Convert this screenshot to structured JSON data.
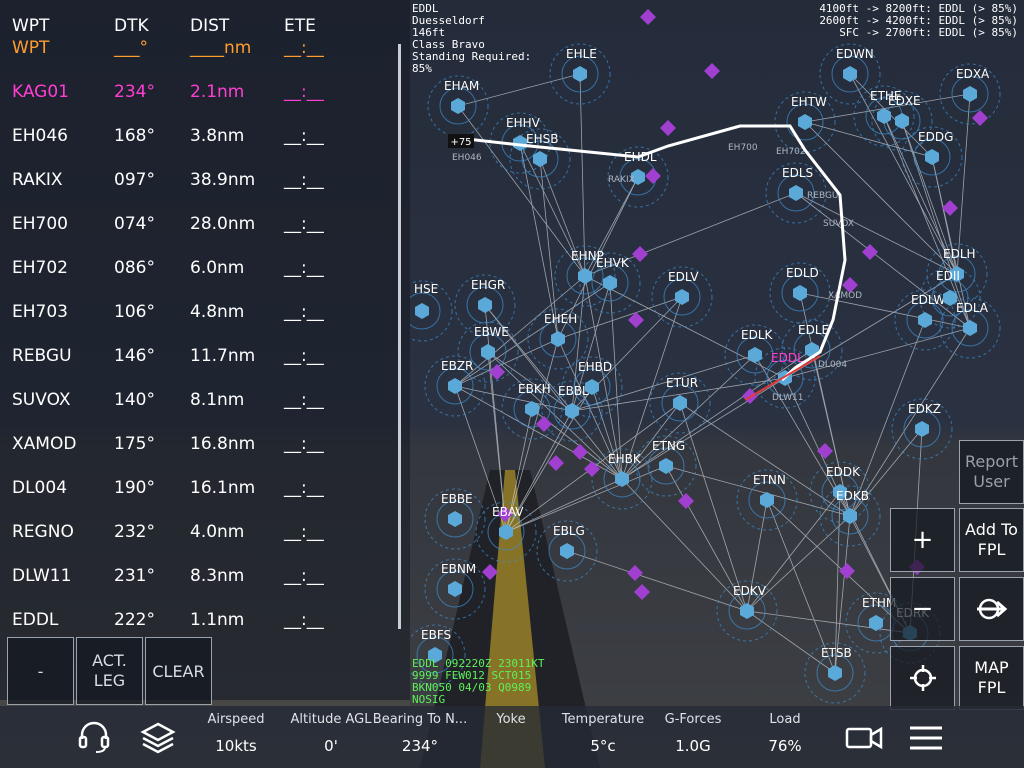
{
  "fpl": {
    "headers": {
      "wpt": "WPT",
      "dtk": "DTK",
      "dist": "DIST",
      "ete": "ETE"
    },
    "partial_row": {
      "wpt": "WPT",
      "dtk": "___°",
      "dist": "____nm",
      "ete": "__:__"
    },
    "rows": [
      {
        "wpt": "KAG01",
        "dtk": "234°",
        "dist": "2.1nm",
        "ete": "__:__",
        "active": true
      },
      {
        "wpt": "EH046",
        "dtk": "168°",
        "dist": "3.8nm",
        "ete": "__:__"
      },
      {
        "wpt": "RAKIX",
        "dtk": "097°",
        "dist": "38.9nm",
        "ete": "__:__"
      },
      {
        "wpt": "EH700",
        "dtk": "074°",
        "dist": "28.0nm",
        "ete": "__:__"
      },
      {
        "wpt": "EH702",
        "dtk": "086°",
        "dist": "6.0nm",
        "ete": "__:__"
      },
      {
        "wpt": "EH703",
        "dtk": "106°",
        "dist": "4.8nm",
        "ete": "__:__"
      },
      {
        "wpt": "REBGU",
        "dtk": "146°",
        "dist": "11.7nm",
        "ete": "__:__"
      },
      {
        "wpt": "SUVOX",
        "dtk": "140°",
        "dist": "8.1nm",
        "ete": "__:__"
      },
      {
        "wpt": "XAMOD",
        "dtk": "175°",
        "dist": "16.8nm",
        "ete": "__:__"
      },
      {
        "wpt": "DL004",
        "dtk": "190°",
        "dist": "16.1nm",
        "ete": "__:__"
      },
      {
        "wpt": "REGNO",
        "dtk": "232°",
        "dist": "4.0nm",
        "ete": "__:__"
      },
      {
        "wpt": "DLW11",
        "dtk": "231°",
        "dist": "8.3nm",
        "ete": "__:__"
      },
      {
        "wpt": "EDDL",
        "dtk": "222°",
        "dist": "1.1nm",
        "ete": "__:__"
      }
    ],
    "buttons": {
      "dash": "-",
      "act_leg_1": "ACT.",
      "act_leg_2": "LEG",
      "clear": "CLEAR"
    }
  },
  "map": {
    "airport_info": [
      "EDDL",
      "Duesseldorf",
      "146ft",
      "Class Bravo",
      "Standing Required:",
      "85%"
    ],
    "altitude_info": [
      "4100ft -> 8200ft: EDDL (> 85%)",
      "2600ft -> 4200ft: EDDL (> 85%)",
      "SFC -> 2700ft: EDDL (> 85%)"
    ],
    "metar": [
      "EDDL 092220Z 23011KT",
      "9999 FEW012 SCT015",
      "BKN050 04/03 Q0989",
      "NOSIG"
    ],
    "airports": [
      "EDDL",
      "EHLE",
      "EDWN",
      "EDXA",
      "EHAM",
      "EHHV",
      "EHSB",
      "EHTW",
      "ETHE",
      "EDXE",
      "EDDG",
      "EHDL",
      "EDLS",
      "EHNP",
      "EHVK",
      "EDLV",
      "EDLH",
      "EDLD",
      "EDLW",
      "EDLA",
      "EHGR",
      "EBWE",
      "EHEH",
      "EDLK",
      "EDLE",
      "EBZR",
      "EHBD",
      "EBKH",
      "EBBL",
      "ETUR",
      "EDKZ",
      "EHBK",
      "ETNG",
      "EDDK",
      "EDKB",
      "ETNN",
      "EBBE",
      "EBAV",
      "EBLG",
      "EBNM",
      "EDKV",
      "ETHM",
      "EBFS",
      "ETSB",
      "HSE",
      "EDII",
      "EDRK"
    ],
    "fixes": [
      "EH700",
      "EH702",
      "RAKIX",
      "SUVOX",
      "XAMOD",
      "DL004",
      "DLW11",
      "EH046",
      "REBGU"
    ],
    "waypoint_badge": "+75",
    "colors": {
      "route": "#ffffff",
      "navaid": "#5aa9d8",
      "vor_ring": "#3f8fd0",
      "ndb": "#a03fd0",
      "active": "#ff3fd4"
    }
  },
  "controls": {
    "report_1": "Report",
    "report_2": "User",
    "zoom_in": "+",
    "zoom_out": "−",
    "add_fpl_1": "Add To",
    "add_fpl_2": "FPL",
    "map_fpl_1": "MAP",
    "map_fpl_2": "FPL"
  },
  "bottom_bar": {
    "gauges": [
      {
        "label": "Airspeed",
        "value": "10kts"
      },
      {
        "label": "Altitude AGL",
        "value": "0'"
      },
      {
        "label": "Bearing To N...",
        "value": "234°"
      },
      {
        "label": "Yoke",
        "value": ""
      },
      {
        "label": "Temperature",
        "value": "5°c"
      },
      {
        "label": "G-Forces",
        "value": "1.0G"
      },
      {
        "label": "Load",
        "value": "76%"
      }
    ]
  }
}
